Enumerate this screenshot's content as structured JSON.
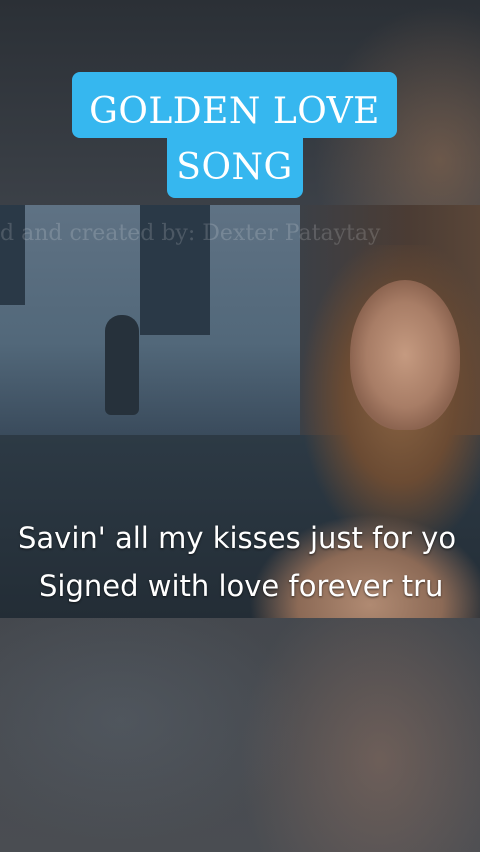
{
  "title": {
    "line1": "GOLDEN LOVE",
    "line2": "SONG"
  },
  "video": {
    "watermark": "d and created by: Dexter Pataytay",
    "lyrics": [
      "Savin' all my kisses just for yo",
      "Signed with love forever tru"
    ]
  },
  "colors": {
    "badge": "#36b7ef",
    "lyric_text": "#ffffff"
  }
}
